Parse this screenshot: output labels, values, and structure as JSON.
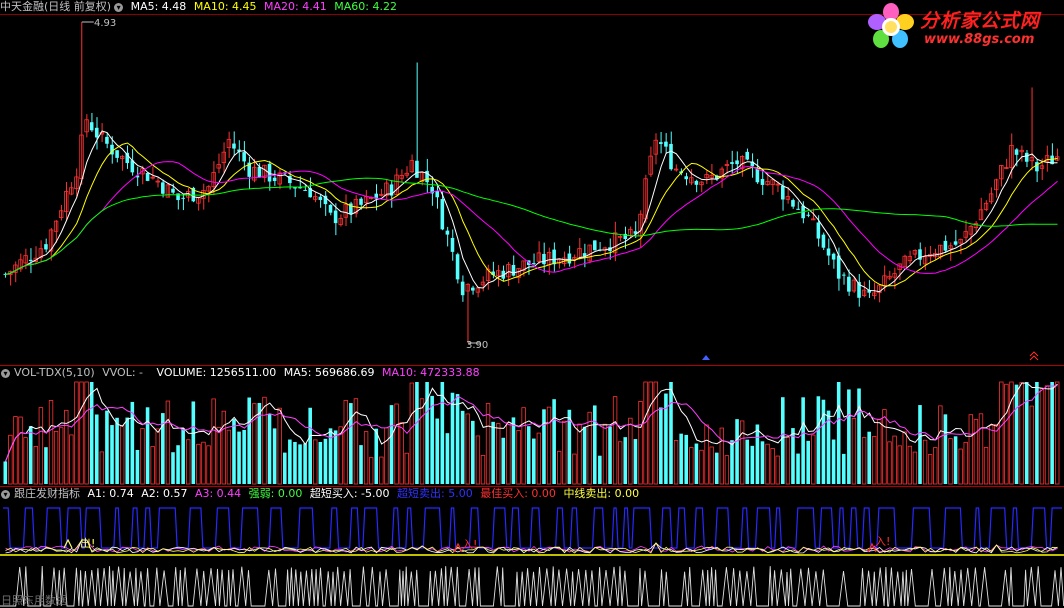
{
  "main_header": {
    "stock": "中天金融(日线 前复权)",
    "ma5": "MA5: 4.48",
    "ma10": "MA10: 4.45",
    "ma20": "MA20: 4.41",
    "ma60": "MA60: 4.22"
  },
  "vol_header": {
    "name": "VOL-TDX(5,10)",
    "vvol": "VVOL: -",
    "volume": "VOLUME: 1256511.00",
    "ma5": "MA5: 569686.69",
    "ma10": "MA10: 472333.88"
  },
  "ind_header": {
    "name": "跟庄发财指标",
    "a1": "A1: 0.74",
    "a2": "A2: 0.57",
    "a3": "A3: 0.44",
    "qiangruo": "强弱: 0.00",
    "chaoduan_buy": "超短买入: -5.00",
    "chaoduan_sell": "超短卖出: 5.00",
    "best_buy": "最佳买入: 0.00",
    "mid_sell": "中线卖出: 0.00"
  },
  "logo": {
    "name": "分析家公式网",
    "url": "www.88gs.com"
  },
  "colors": {
    "up": "#ff3232",
    "down": "#54ffff",
    "ma5": "#ffffff",
    "ma10": "#ffff00",
    "ma20": "#ff00ff",
    "ma60": "#00ff00"
  },
  "chart_data": {
    "type": "candlestick",
    "price_range": [
      3.9,
      4.93
    ],
    "high_label": "4.93",
    "low_label": "3.90",
    "signals": {
      "out": "出!",
      "in": "入!"
    },
    "watermark": "日照东用数据"
  }
}
